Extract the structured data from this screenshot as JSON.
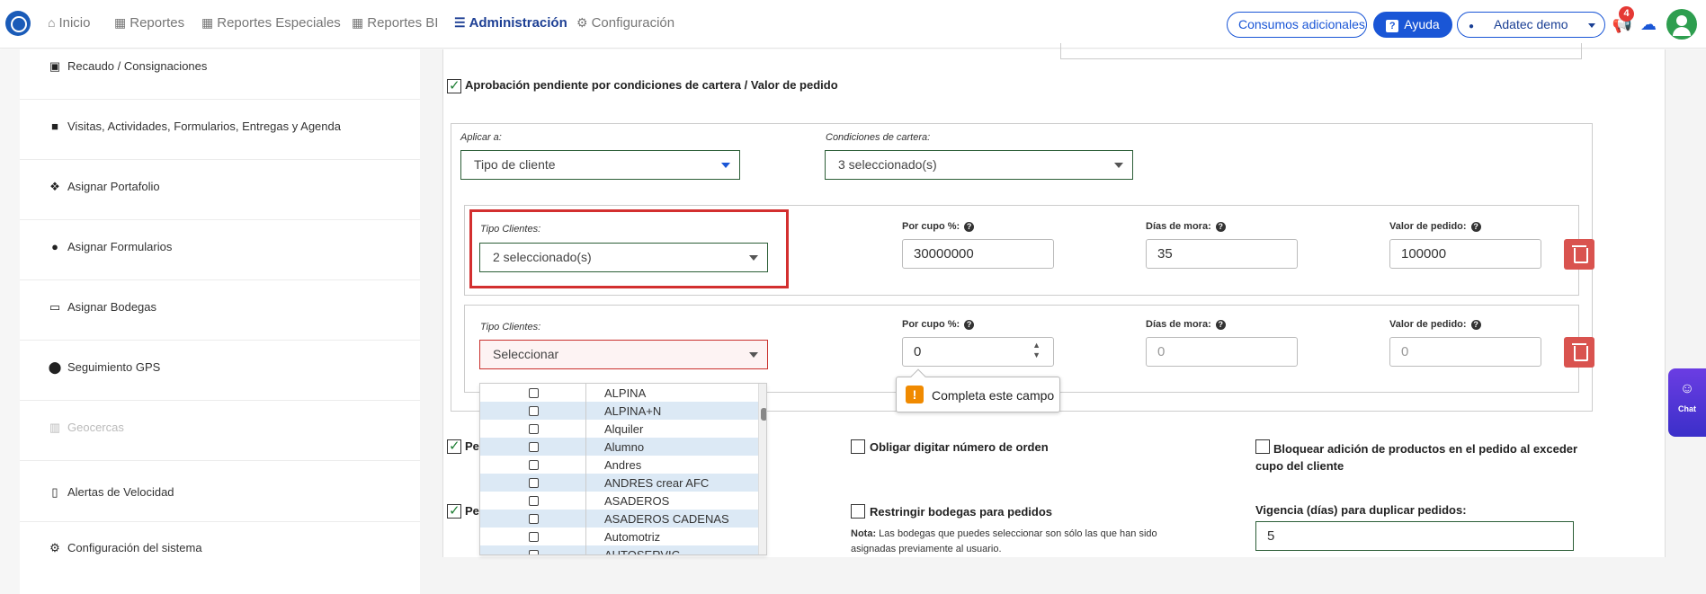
{
  "nav": {
    "items": [
      {
        "label": "Inicio",
        "icon": "home-icon"
      },
      {
        "label": "Reportes",
        "icon": "grid-icon"
      },
      {
        "label": "Reportes Especiales",
        "icon": "grid-icon"
      },
      {
        "label": "Reportes BI",
        "icon": "grid-icon"
      },
      {
        "label": "Administración",
        "icon": "sliders-icon",
        "active": true
      },
      {
        "label": "Configuración",
        "icon": "gear-icon"
      }
    ],
    "consumos_label": "Consumos adicionales",
    "ayuda_label": "Ayuda",
    "user_label": "Adatec demo",
    "notification_count": "4"
  },
  "sidebar": {
    "items": [
      {
        "label": "Recaudo / Consignaciones",
        "icon": "money-icon"
      },
      {
        "label": "Visitas, Actividades, Formularios, Entregas y Agenda",
        "icon": "briefcase-icon"
      },
      {
        "label": "Asignar Portafolio",
        "icon": "cubes-icon"
      },
      {
        "label": "Asignar Formularios",
        "icon": "question-circle-icon"
      },
      {
        "label": "Asignar Bodegas",
        "icon": "inbox-icon"
      },
      {
        "label": "Seguimiento GPS",
        "icon": "map-marker-icon"
      },
      {
        "label": "Geocercas",
        "icon": "map-icon",
        "disabled": true
      },
      {
        "label": "Alertas de Velocidad",
        "icon": "mobile-alert-icon"
      },
      {
        "label": "Configuración del sistema",
        "icon": "cogs-icon"
      }
    ]
  },
  "form": {
    "aprobacion_label": "Aprobación pendiente por condiciones de cartera / Valor de pedido",
    "aplicar_label": "Aplicar a:",
    "aplicar_value": "Tipo de cliente",
    "condiciones_label": "Condiciones de cartera:",
    "condiciones_value": "3 seleccionado(s)",
    "rows": [
      {
        "tipo_label": "Tipo Clientes:",
        "tipo_value": "2 seleccionado(s)",
        "cupo_label": "Por cupo %:",
        "cupo_value": "30000000",
        "mora_label": "Días de mora:",
        "mora_value": "35",
        "pedido_label": "Valor de pedido:",
        "pedido_value": "100000"
      },
      {
        "tipo_label": "Tipo Clientes:",
        "tipo_value": "Seleccionar",
        "cupo_label": "Por cupo %:",
        "cupo_value": "0",
        "mora_label": "Días de mora:",
        "mora_placeholder": "0",
        "pedido_label": "Valor de pedido:",
        "pedido_placeholder": "0"
      }
    ],
    "tooltip": "Completa este campo",
    "dropdown_options": [
      "ALPINA",
      "ALPINA+N",
      "Alquiler",
      "Alumno",
      "Andres",
      "ANDRES crear AFC",
      "ASADEROS",
      "ASADEROS CADENAS",
      "Automotriz",
      "AUTOSERVIC"
    ],
    "perm1_label": "Pe",
    "perm2_label": "Pe",
    "obligar_label": "Obligar digitar número de orden",
    "bloquear_label": "Bloquear adición de productos en el pedido al exceder cupo del cliente",
    "restringir_label": "Restringir bodegas para pedidos",
    "nota_bold": "Nota:",
    "nota_text": "Las bodegas que puedes seleccionar son sólo las que han sido asignadas previamente al usuario.",
    "vigencia_label": "Vigencia (días) para duplicar pedidos:",
    "vigencia_value": "5"
  },
  "chat": {
    "label": "Chat"
  },
  "colors": {
    "primary": "#1a56d6",
    "danger": "#d9534f",
    "highlight": "#d32f2f",
    "success": "#2e9e4f"
  }
}
